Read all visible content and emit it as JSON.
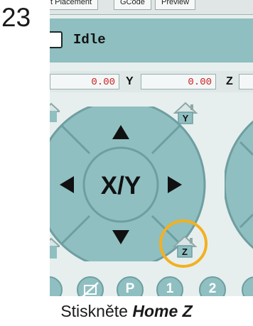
{
  "step": "23",
  "tabs": [
    "t Placement",
    "GCode",
    "Preview"
  ],
  "status": {
    "text": "Idle"
  },
  "coords": {
    "x_value": "0.00",
    "y_label": "Y",
    "y_value": "0.00",
    "z_label": "Z"
  },
  "jog": {
    "center_label": "X/Y"
  },
  "home": {
    "y_label": "Y",
    "z_label": "Z"
  },
  "bottom_buttons": [
    "",
    "",
    "P",
    "1",
    "2"
  ],
  "caption": {
    "prefix": "Stiskněte ",
    "emphasis": "Home Z"
  },
  "colors": {
    "accent": "#8fbfc1",
    "highlight": "#f3b020",
    "coord_text": "#cc2222"
  }
}
